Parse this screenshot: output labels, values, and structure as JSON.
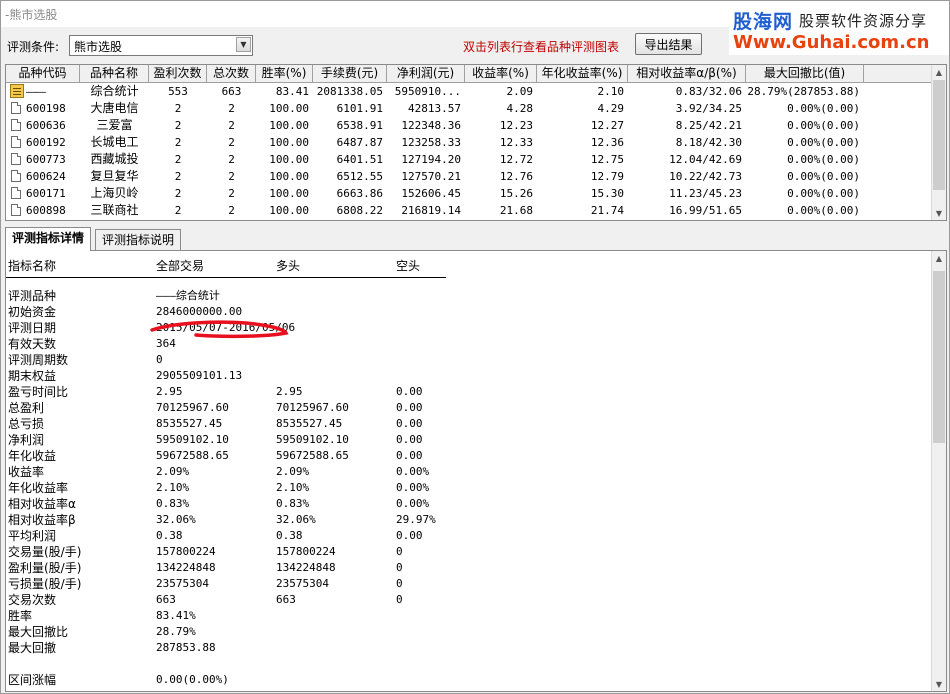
{
  "window": {
    "title": "-熊市选股"
  },
  "brand": {
    "name": "股海网",
    "slogan": "股票软件资源分享",
    "url": "Www.Guhai.com.cn"
  },
  "toolbar": {
    "condition_label": "评测条件:",
    "condition_value": "熊市选股",
    "hint": "双击列表行查看品种评测图表",
    "export_label": "导出结果"
  },
  "grid": {
    "columns": [
      "品种代码",
      "品种名称",
      "盈利次数",
      "总次数",
      "胜率(%)",
      "手续费(元)",
      "净利润(元)",
      "收益率(%)",
      "年化收益率(%)",
      "相对收益率α/β(%)",
      "最大回撤比(值)"
    ],
    "rows": [
      {
        "code": "———",
        "name": "综合统计",
        "win_count": "553",
        "total": "663",
        "win_rate": "83.41",
        "fee": "2081338.05",
        "profit": "5950910...",
        "return": "2.09",
        "annual": "2.10",
        "alpha_beta": "0.83/32.06",
        "drawdown": "28.79%(287853.88)",
        "summary": true
      },
      {
        "code": "600198",
        "name": "大唐电信",
        "win_count": "2",
        "total": "2",
        "win_rate": "100.00",
        "fee": "6101.91",
        "profit": "42813.57",
        "return": "4.28",
        "annual": "4.29",
        "alpha_beta": "3.92/34.25",
        "drawdown": "0.00%(0.00)"
      },
      {
        "code": "600636",
        "name": "三爱富",
        "win_count": "2",
        "total": "2",
        "win_rate": "100.00",
        "fee": "6538.91",
        "profit": "122348.36",
        "return": "12.23",
        "annual": "12.27",
        "alpha_beta": "8.25/42.21",
        "drawdown": "0.00%(0.00)"
      },
      {
        "code": "600192",
        "name": "长城电工",
        "win_count": "2",
        "total": "2",
        "win_rate": "100.00",
        "fee": "6487.87",
        "profit": "123258.33",
        "return": "12.33",
        "annual": "12.36",
        "alpha_beta": "8.18/42.30",
        "drawdown": "0.00%(0.00)"
      },
      {
        "code": "600773",
        "name": "西藏城投",
        "win_count": "2",
        "total": "2",
        "win_rate": "100.00",
        "fee": "6401.51",
        "profit": "127194.20",
        "return": "12.72",
        "annual": "12.75",
        "alpha_beta": "12.04/42.69",
        "drawdown": "0.00%(0.00)"
      },
      {
        "code": "600624",
        "name": "复旦复华",
        "win_count": "2",
        "total": "2",
        "win_rate": "100.00",
        "fee": "6512.55",
        "profit": "127570.21",
        "return": "12.76",
        "annual": "12.79",
        "alpha_beta": "10.22/42.73",
        "drawdown": "0.00%(0.00)"
      },
      {
        "code": "600171",
        "name": "上海贝岭",
        "win_count": "2",
        "total": "2",
        "win_rate": "100.00",
        "fee": "6663.86",
        "profit": "152606.45",
        "return": "15.26",
        "annual": "15.30",
        "alpha_beta": "11.23/45.23",
        "drawdown": "0.00%(0.00)"
      },
      {
        "code": "600898",
        "name": "三联商社",
        "win_count": "2",
        "total": "2",
        "win_rate": "100.00",
        "fee": "6808.22",
        "profit": "216819.14",
        "return": "21.68",
        "annual": "21.74",
        "alpha_beta": "16.99/51.65",
        "drawdown": "0.00%(0.00)"
      }
    ]
  },
  "tabs": [
    {
      "label": "评测指标详情",
      "active": true
    },
    {
      "label": "评测指标说明",
      "active": false
    }
  ],
  "detail": {
    "headers": [
      "指标名称",
      "全部交易",
      "多头",
      "空头"
    ],
    "rows": [
      {
        "name": "评测品种",
        "all": "———综合统计",
        "long": "",
        "short": ""
      },
      {
        "name": "初始资金",
        "all": "2846000000.00",
        "long": "",
        "short": ""
      },
      {
        "name": "评测日期",
        "all": "2015/05/07-2016/05/06",
        "long": "",
        "short": ""
      },
      {
        "name": "有效天数",
        "all": "364",
        "long": "",
        "short": ""
      },
      {
        "name": "评测周期数",
        "all": "0",
        "long": "",
        "short": ""
      },
      {
        "name": "期末权益",
        "all": "2905509101.13",
        "long": "",
        "short": ""
      },
      {
        "name": "盈亏时间比",
        "all": "2.95",
        "long": "2.95",
        "short": "0.00"
      },
      {
        "name": "总盈利",
        "all": "70125967.60",
        "long": "70125967.60",
        "short": "0.00"
      },
      {
        "name": "总亏损",
        "all": "8535527.45",
        "long": "8535527.45",
        "short": "0.00"
      },
      {
        "name": "净利润",
        "all": "59509102.10",
        "long": "59509102.10",
        "short": "0.00"
      },
      {
        "name": "年化收益",
        "all": "59672588.65",
        "long": "59672588.65",
        "short": "0.00"
      },
      {
        "name": "收益率",
        "all": "2.09%",
        "long": "2.09%",
        "short": "0.00%"
      },
      {
        "name": "年化收益率",
        "all": "2.10%",
        "long": "2.10%",
        "short": "0.00%"
      },
      {
        "name": "相对收益率α",
        "all": "0.83%",
        "long": " 0.83%",
        "short": " 0.00%"
      },
      {
        "name": "相对收益率β",
        "all": "32.06%",
        "long": " 32.06%",
        "short": " 29.97%"
      },
      {
        "name": "平均利润",
        "all": "0.38",
        "long": "0.38",
        "short": "0.00"
      },
      {
        "name": "交易量(股/手)",
        "all": "157800224",
        "long": "157800224",
        "short": "0"
      },
      {
        "name": "盈利量(股/手)",
        "all": "134224848",
        "long": "134224848",
        "short": "0"
      },
      {
        "name": "亏损量(股/手)",
        "all": "23575304",
        "long": "23575304",
        "short": "0"
      },
      {
        "name": "交易次数",
        "all": "663",
        "long": "663",
        "short": "0"
      },
      {
        "name": "胜率",
        "all": "83.41%",
        "long": "",
        "short": ""
      },
      {
        "name": "最大回撤比",
        "all": "28.79%",
        "long": "",
        "short": ""
      },
      {
        "name": "最大回撤",
        "all": "287853.88",
        "long": "",
        "short": ""
      },
      {
        "name": "",
        "all": "",
        "long": "",
        "short": ""
      },
      {
        "name": "区间涨幅",
        "all": "0.00(0.00%)",
        "long": "",
        "short": ""
      }
    ]
  },
  "colors": {
    "hint": "#c00000",
    "brand_blue": "#1f5fd0",
    "brand_orange": "#e8420e",
    "annotation": "#e8101e"
  },
  "icons": {
    "summary_row": "summary-table-icon",
    "stock_row": "document-icon"
  }
}
